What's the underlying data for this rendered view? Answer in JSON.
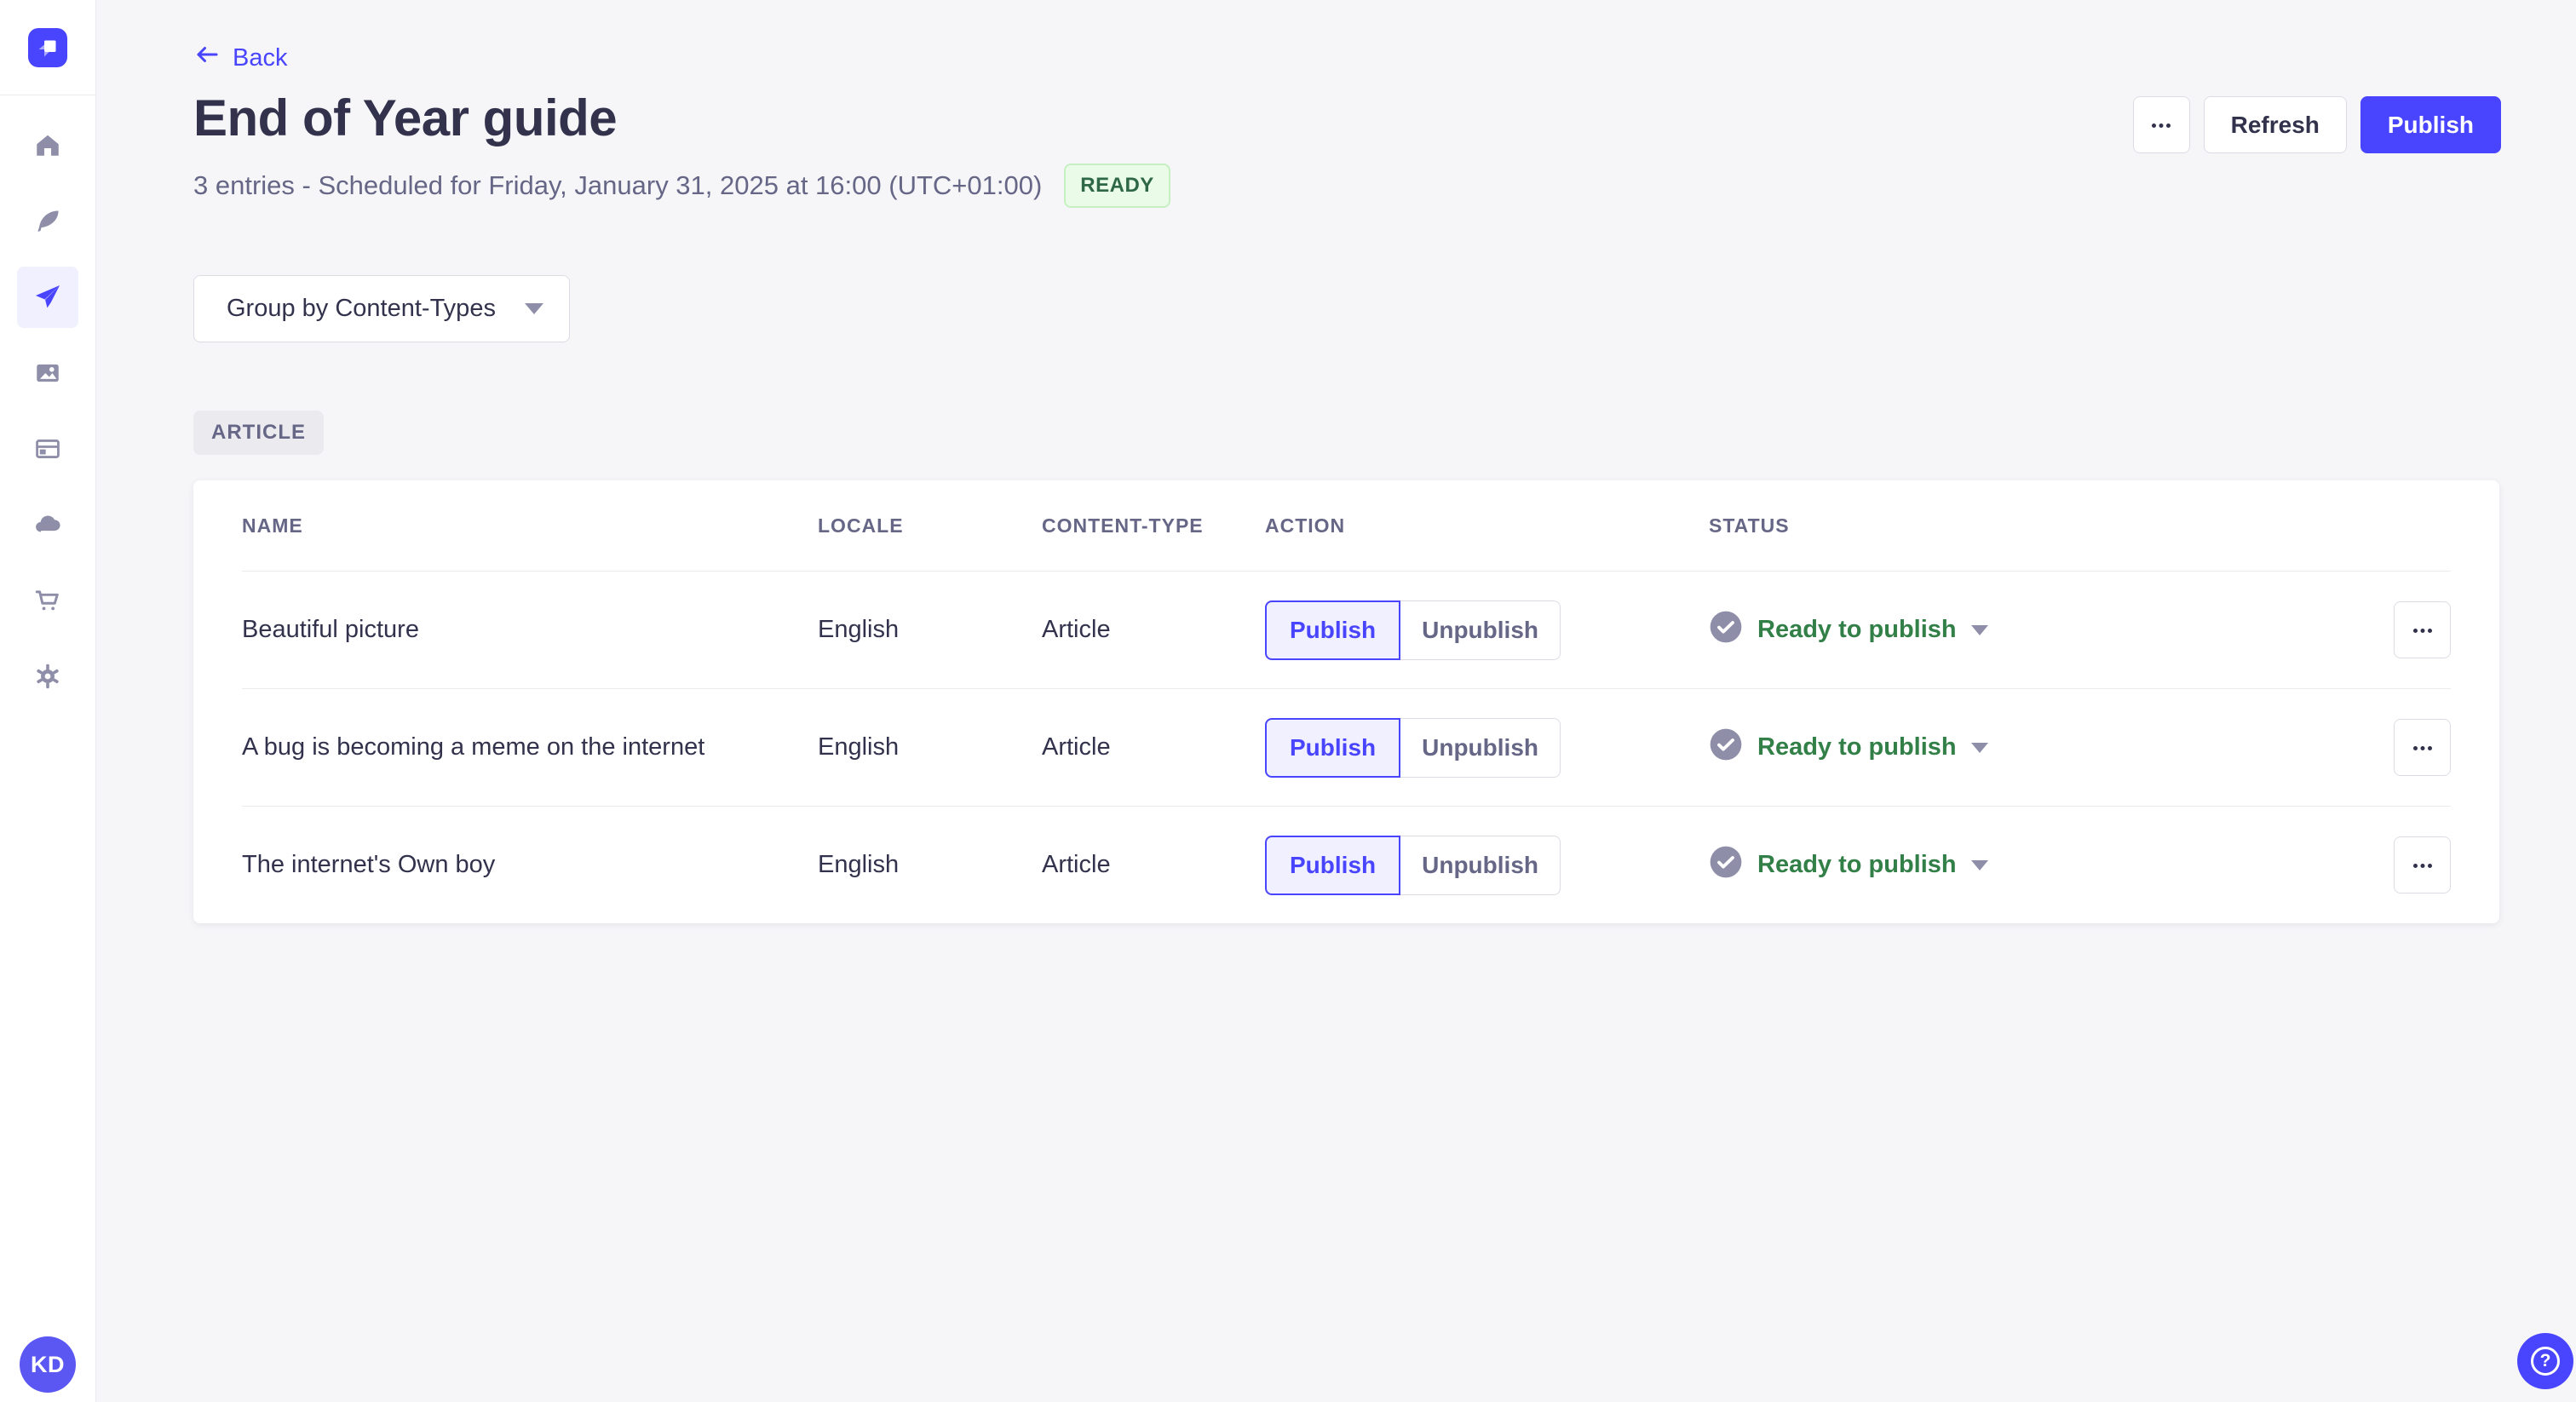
{
  "colors": {
    "primary": "#4945ff",
    "primary_light_bg": "#f0f0ff",
    "success_text": "#328048",
    "ready_badge_bg": "#eafbe7",
    "ready_badge_border": "#c6f0c2",
    "ready_badge_text": "#2f6846",
    "page_bg": "#f6f6f9",
    "border_neutral": "#dcdce4",
    "text_dark": "#32324d",
    "text_muted": "#666687",
    "icon_muted": "#8e8ea9"
  },
  "sidebar": {
    "logo_icon": "strapi-logo",
    "items": [
      {
        "icon": "home-icon",
        "active": false
      },
      {
        "icon": "feather-icon",
        "active": false
      },
      {
        "icon": "paper-plane-icon",
        "active": true
      },
      {
        "icon": "images-icon",
        "active": false
      },
      {
        "icon": "layout-icon",
        "active": false
      },
      {
        "icon": "cloud-icon",
        "active": false
      },
      {
        "icon": "cart-icon",
        "active": false
      },
      {
        "icon": "gear-icon",
        "active": false
      }
    ],
    "avatar_initials": "KD"
  },
  "header": {
    "back_label": "Back",
    "title": "End of Year guide",
    "subtitle": "3 entries - Scheduled for Friday, January 31, 2025 at 16:00 (UTC+01:00)",
    "status_badge": "READY",
    "refresh_label": "Refresh",
    "publish_label": "Publish"
  },
  "toolbar": {
    "group_by_label": "Group by Content-Types"
  },
  "section": {
    "badge": "ARTICLE"
  },
  "table": {
    "columns": [
      "NAME",
      "LOCALE",
      "CONTENT-TYPE",
      "ACTION",
      "STATUS"
    ],
    "action_labels": {
      "publish": "Publish",
      "unpublish": "Unpublish"
    },
    "rows": [
      {
        "name": "Beautiful picture",
        "locale": "English",
        "content_type": "Article",
        "status": "Ready to publish"
      },
      {
        "name": "A bug is becoming a meme on the internet",
        "locale": "English",
        "content_type": "Article",
        "status": "Ready to publish"
      },
      {
        "name": "The internet's Own boy",
        "locale": "English",
        "content_type": "Article",
        "status": "Ready to publish"
      }
    ]
  },
  "fab": {
    "icon": "question-mark-icon",
    "glyph": "?"
  }
}
